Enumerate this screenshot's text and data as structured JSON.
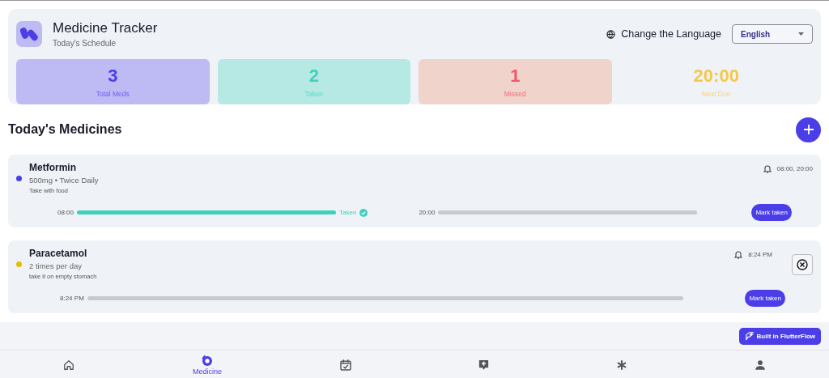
{
  "header": {
    "title": "Medicine Tracker",
    "subtitle": "Today's Schedule",
    "language_label": "Change the Language",
    "language": {
      "value": "English"
    }
  },
  "stats": [
    {
      "kind": "total",
      "value": "3",
      "label": "Total Meds"
    },
    {
      "kind": "taken",
      "value": "2",
      "label": "Taken"
    },
    {
      "kind": "missed",
      "value": "1",
      "label": "Missed"
    },
    {
      "kind": "next",
      "value": "20:00",
      "label": "Next Due"
    }
  ],
  "section_title": "Today's Medicines",
  "medicines": [
    {
      "name": "Metformin",
      "color": "#4b3ee8",
      "dosage": "500mg • Twice Daily",
      "note": "Take with food",
      "reminder": "08:00, 20:00",
      "removable": false,
      "slots": [
        {
          "time": "08:00",
          "taken": true,
          "status": "Taken"
        },
        {
          "time": "20:00",
          "taken": false
        }
      ],
      "action": "Mark taken"
    },
    {
      "name": "Paracetamol",
      "color": "#e0c000",
      "dosage": "2 times per day",
      "note": "take it on empty stomach",
      "reminder": "8:24 PM",
      "removable": true,
      "slots": [
        {
          "time": "8:24 PM",
          "taken": false
        }
      ],
      "action": "Mark taken"
    }
  ],
  "badge": "Built in FlutterFlow",
  "nav": [
    {
      "kind": "home",
      "selected": false
    },
    {
      "kind": "medicine",
      "label": "Medicine",
      "selected": true
    },
    {
      "kind": "calendar",
      "selected": false
    },
    {
      "kind": "medical",
      "selected": false
    },
    {
      "kind": "asterisk",
      "selected": false
    },
    {
      "kind": "person",
      "selected": false
    }
  ]
}
